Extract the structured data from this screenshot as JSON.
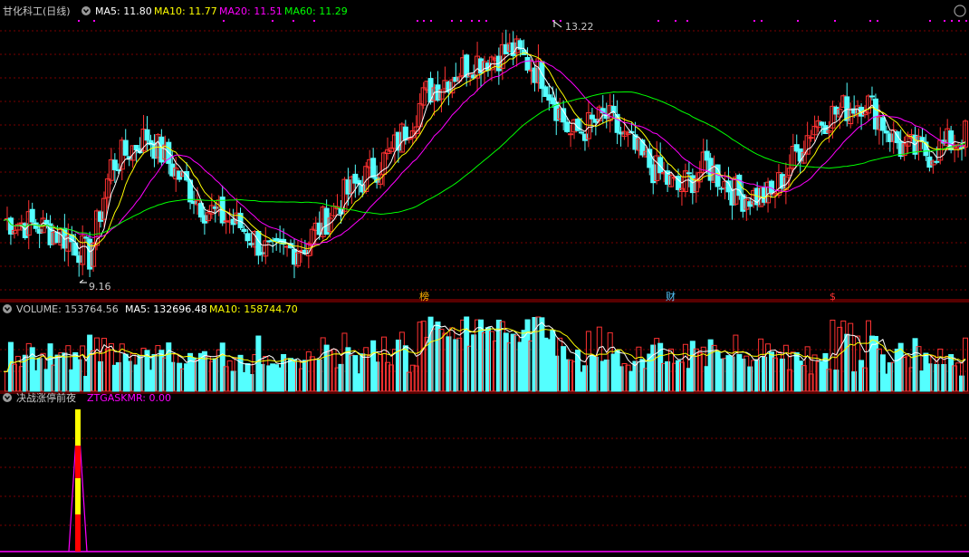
{
  "header": {
    "title": "甘化科工(日线)",
    "ma5": "MA5: 11.80",
    "ma10": "MA10: 11.77",
    "ma20": "MA20: 11.51",
    "ma60": "MA60: 11.29",
    "title_color": "#c8c8c8",
    "ma5_color": "#ffffff",
    "ma10_color": "#ffff00",
    "ma20_color": "#ff00ff",
    "ma60_color": "#00ff00"
  },
  "volume_header": {
    "volume": "VOLUME: 153764.56",
    "ma5": "MA5: 132696.48",
    "ma10": "MA10: 158744.70"
  },
  "indicator_header": {
    "name": "决战涨停前夜",
    "value": "ZTGASKMR: 0.00"
  },
  "markers": {
    "high_label": "13.22",
    "low_label": "9.16",
    "bang": "榜",
    "cai": "财",
    "dollar": "$"
  },
  "icons": {
    "collapse": "chevron-down-icon",
    "maximize": "circle-icon"
  },
  "colors": {
    "up": "#ff3232",
    "down": "#54ffff",
    "grid": "#7a0000",
    "border": "#b00000",
    "indicator_line": "#ff00ff",
    "spike_red": "#ff0000",
    "spike_yellow": "#ffff00"
  },
  "chart_data": [
    {
      "type": "candlestick",
      "title": "甘化科工(日线)",
      "ylim": [
        8.9,
        13.5
      ],
      "high_marker": 13.22,
      "low_marker": 9.16,
      "series": [
        {
          "name": "MA5",
          "values": [
            11.8
          ]
        },
        {
          "name": "MA10",
          "values": [
            11.77
          ]
        },
        {
          "name": "MA20",
          "values": [
            11.51
          ]
        },
        {
          "name": "MA60",
          "values": [
            11.29
          ]
        }
      ]
    },
    {
      "type": "bar",
      "title": "VOLUME",
      "series": [
        {
          "name": "VOLUME",
          "values": [
            153764.56
          ]
        },
        {
          "name": "MA5",
          "values": [
            132696.48
          ]
        },
        {
          "name": "MA10",
          "values": [
            158744.7
          ]
        }
      ]
    },
    {
      "type": "line",
      "title": "决战涨停前夜",
      "series": [
        {
          "name": "ZTGASKMR",
          "values": [
            0.0
          ]
        }
      ]
    }
  ]
}
